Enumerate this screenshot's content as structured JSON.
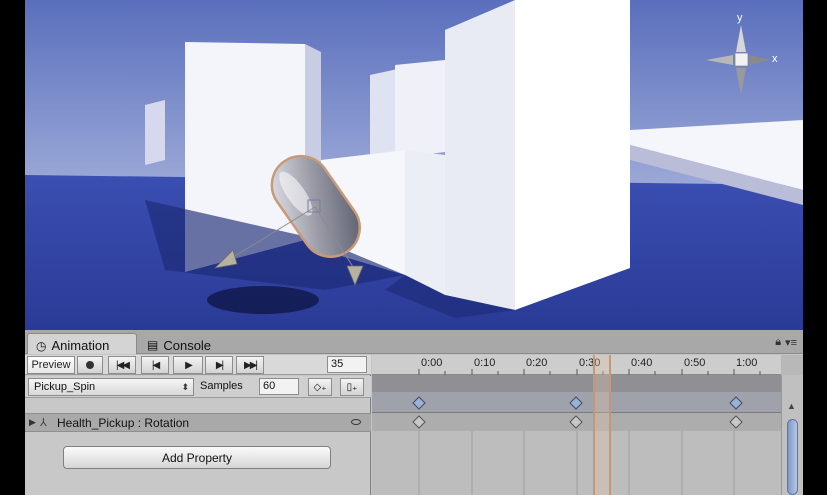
{
  "scene": {
    "gizmo": {
      "y_label": "y",
      "x_label": "x"
    }
  },
  "animation_window": {
    "tabs": [
      {
        "label": "Animation",
        "icon": "clock-icon",
        "active": true
      },
      {
        "label": "Console",
        "icon": "document-icon",
        "active": false
      }
    ],
    "toolbar": {
      "preview_label": "Preview",
      "buttons": [
        "record-icon",
        "first-key-icon",
        "prev-key-icon",
        "play-icon",
        "next-key-icon",
        "last-key-icon"
      ],
      "current_frame": "35"
    },
    "clip": {
      "name": "Pickup_Spin",
      "samples_label": "Samples",
      "samples_value": "60"
    },
    "property": {
      "label": "Health_Pickup : Rotation"
    },
    "add_property_label": "Add Property",
    "timeline": {
      "ticks": [
        "0:00",
        "0:10",
        "0:20",
        "0:30",
        "0:40",
        "0:50",
        "1:00"
      ],
      "keyframes": [
        "0:00",
        "0:30",
        "1:00"
      ],
      "playhead": "0:35"
    }
  }
}
